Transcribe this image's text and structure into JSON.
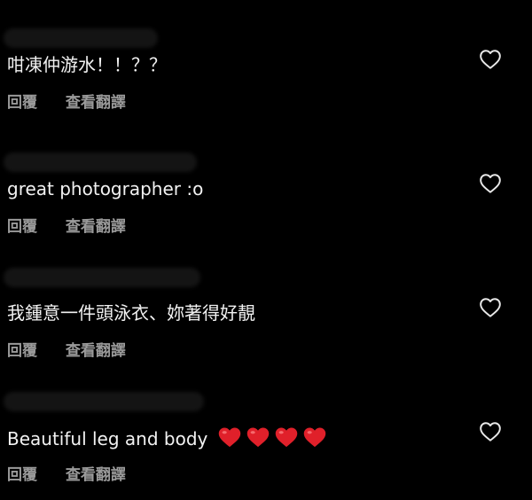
{
  "colors": {
    "background": "#000000",
    "text": "#f2f2f2",
    "action": "#9a9a9a",
    "emoji_heart": "#e0202a"
  },
  "comments": [
    {
      "text": "咁凍仲游水！！？？",
      "reply": "回覆",
      "translate": "查看翻譯",
      "emoji_hearts": 0
    },
    {
      "text": "great photographer :o",
      "reply": "回覆",
      "translate": "查看翻譯",
      "emoji_hearts": 0
    },
    {
      "text": "我鍾意一件頭泳衣、妳著得好靚",
      "reply": "回覆",
      "translate": "查看翻譯",
      "emoji_hearts": 0
    },
    {
      "text": "Beautiful leg and body",
      "reply": "回覆",
      "translate": "查看翻譯",
      "emoji_hearts": 4
    }
  ],
  "icons": {
    "like": "heart-outline-icon",
    "emoji": "red-heart-emoji"
  }
}
